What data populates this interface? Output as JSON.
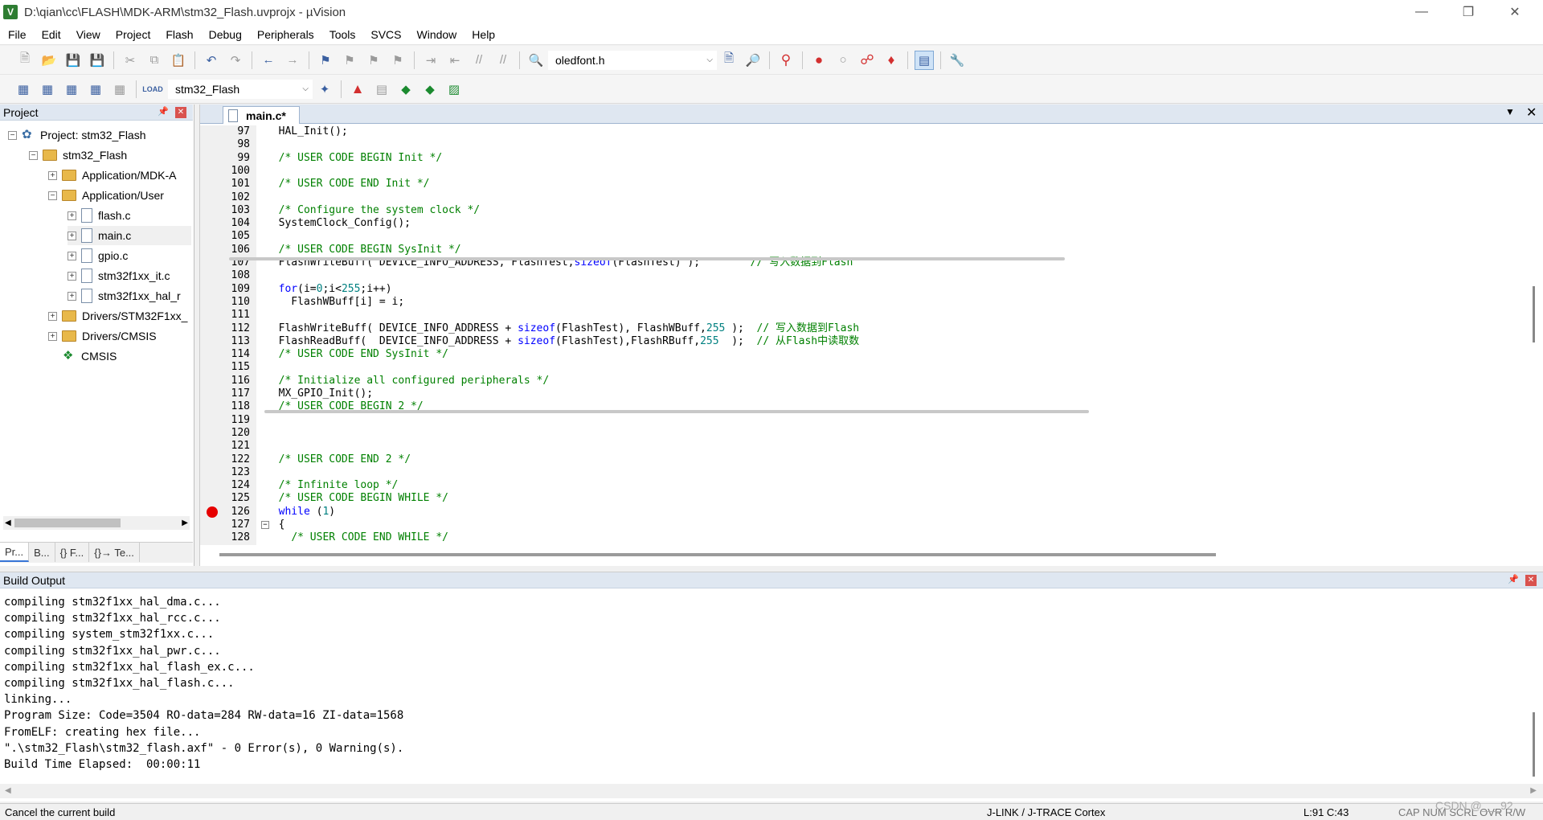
{
  "window": {
    "title": "D:\\qian\\cc\\FLASH\\MDK-ARM\\stm32_Flash.uvprojx - µVision",
    "app_icon": "V"
  },
  "menu": [
    "File",
    "Edit",
    "View",
    "Project",
    "Flash",
    "Debug",
    "Peripherals",
    "Tools",
    "SVCS",
    "Window",
    "Help"
  ],
  "toolbar": {
    "find_combo": "oledfont.h",
    "target_combo": "stm32_Flash"
  },
  "project_panel": {
    "title": "Project",
    "tree": [
      {
        "label": "Project: stm32_Flash"
      },
      {
        "label": "stm32_Flash"
      },
      {
        "label": "Application/MDK-A"
      },
      {
        "label": "Application/User"
      },
      {
        "label": "flash.c"
      },
      {
        "label": "main.c"
      },
      {
        "label": "gpio.c"
      },
      {
        "label": "stm32f1xx_it.c"
      },
      {
        "label": "stm32f1xx_hal_r"
      },
      {
        "label": "Drivers/STM32F1xx_"
      },
      {
        "label": "Drivers/CMSIS"
      },
      {
        "label": "CMSIS"
      }
    ],
    "tabs": [
      "Pr...",
      "B...",
      "{} F...",
      "{}→ Te..."
    ]
  },
  "editor": {
    "active_tab": "main.c*",
    "lines": [
      {
        "n": "97",
        "text": "  HAL_Init();"
      },
      {
        "n": "98",
        "text": ""
      },
      {
        "n": "99",
        "text": "  /* USER CODE BEGIN Init */"
      },
      {
        "n": "100",
        "text": ""
      },
      {
        "n": "101",
        "text": "  /* USER CODE END Init */"
      },
      {
        "n": "102",
        "text": ""
      },
      {
        "n": "103",
        "text": "  /* Configure the system clock */"
      },
      {
        "n": "104",
        "text": "  SystemClock_Config();"
      },
      {
        "n": "105",
        "text": ""
      },
      {
        "n": "106",
        "text": "  /* USER CODE BEGIN SysInit */"
      },
      {
        "n": "107",
        "text": "  FlashWriteBuff( DEVICE_INFO_ADDRESS, FlashTest,sizeof(FlashTest) );        // 写入数据到Flash"
      },
      {
        "n": "108",
        "text": ""
      },
      {
        "n": "109",
        "text": "  for(i=0;i<255;i++)"
      },
      {
        "n": "110",
        "text": "    FlashWBuff[i] = i;"
      },
      {
        "n": "111",
        "text": ""
      },
      {
        "n": "112",
        "text": "  FlashWriteBuff( DEVICE_INFO_ADDRESS + sizeof(FlashTest), FlashWBuff,255 );  // 写入数据到Flash"
      },
      {
        "n": "113",
        "text": "  FlashReadBuff(  DEVICE_INFO_ADDRESS + sizeof(FlashTest),FlashRBuff,255  );  // 从Flash中读取数"
      },
      {
        "n": "114",
        "text": "  /* USER CODE END SysInit */"
      },
      {
        "n": "115",
        "text": ""
      },
      {
        "n": "116",
        "text": "  /* Initialize all configured peripherals */"
      },
      {
        "n": "117",
        "text": "  MX_GPIO_Init();"
      },
      {
        "n": "118",
        "text": "  /* USER CODE BEGIN 2 */"
      },
      {
        "n": "119",
        "text": ""
      },
      {
        "n": "120",
        "text": ""
      },
      {
        "n": "121",
        "text": ""
      },
      {
        "n": "122",
        "text": "  /* USER CODE END 2 */"
      },
      {
        "n": "123",
        "text": ""
      },
      {
        "n": "124",
        "text": "  /* Infinite loop */"
      },
      {
        "n": "125",
        "text": "  /* USER CODE BEGIN WHILE */"
      },
      {
        "n": "126",
        "text": "  while (1)"
      },
      {
        "n": "127",
        "text": "  {"
      },
      {
        "n": "128",
        "text": "    /* USER CODE END WHILE */"
      }
    ]
  },
  "build_output": {
    "title": "Build Output",
    "lines": [
      "compiling stm32f1xx_hal_dma.c...",
      "compiling stm32f1xx_hal_rcc.c...",
      "compiling system_stm32f1xx.c...",
      "compiling stm32f1xx_hal_pwr.c...",
      "compiling stm32f1xx_hal_flash_ex.c...",
      "compiling stm32f1xx_hal_flash.c...",
      "linking...",
      "Program Size: Code=3504 RO-data=284 RW-data=16 ZI-data=1568",
      "FromELF: creating hex file...",
      "\".\\stm32_Flash\\stm32_flash.axf\" - 0 Error(s), 0 Warning(s).",
      "Build Time Elapsed:  00:00:11"
    ]
  },
  "status": {
    "message": "Cancel the current build",
    "debugger": "J-LINK / J-TRACE Cortex",
    "position": "L:91 C:43",
    "indicators": "CAP  NUM  SCRL  OVR  R/W",
    "watermark": "CSDN @___92"
  }
}
